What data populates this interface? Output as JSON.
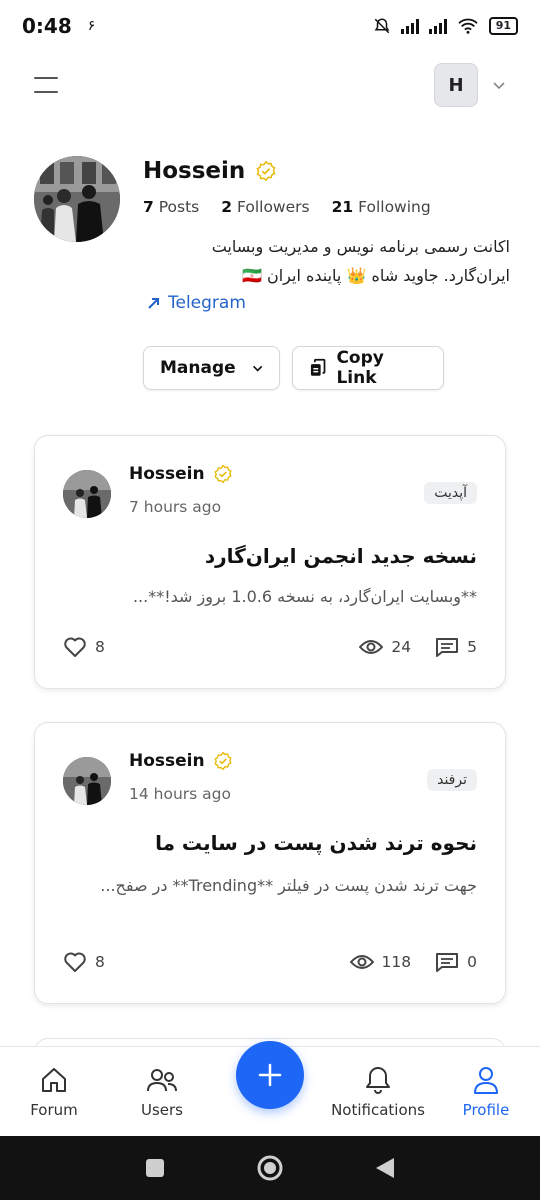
{
  "status_bar": {
    "time": "0:48",
    "extra": "۶",
    "battery": "91"
  },
  "header": {
    "avatar_letter": "H"
  },
  "profile": {
    "name": "Hossein",
    "posts_count": "7",
    "posts_label": "Posts",
    "followers_count": "2",
    "followers_label": "Followers",
    "following_count": "21",
    "following_label": "Following",
    "bio_line1": "اکانت رسمی برنامه نویس و مدیریت وبسایت",
    "bio_line2": "ایران‌گارد. جاوید شاه 👑 پاینده ایران 🇮🇷",
    "telegram_label": "Telegram",
    "manage_label": "Manage",
    "copy_link_label": "Copy Link"
  },
  "posts": [
    {
      "author": "Hossein",
      "time": "7 hours ago",
      "tag": "آپدیت",
      "title": "نسخه جدید انجمن ایران‌گارد",
      "excerpt": "**وبسایت ایران‌گارد، به نسخه 1.0.6 بروز شد!**...",
      "likes": "8",
      "views": "24",
      "comments": "5"
    },
    {
      "author": "Hossein",
      "time": "14 hours ago",
      "tag": "ترفند",
      "title": "نحوه ترند شدن پست در سایت ما",
      "excerpt": "جهت ترند شدن پست در فیلتر **Trending** در صفح...",
      "likes": "8",
      "views": "118",
      "comments": "0"
    }
  ],
  "bottom_nav": {
    "forum": "Forum",
    "users": "Users",
    "notifications": "Notifications",
    "profile": "Profile",
    "active": "profile"
  },
  "colors": {
    "accent": "#1e66f5",
    "verified": "#e6b800",
    "link": "#2563c9"
  },
  "icons": [
    "menu-icon",
    "chevron-down-icon",
    "verified-icon",
    "telegram-icon",
    "copy-icon",
    "heart-icon",
    "eye-icon",
    "comment-icon",
    "home-icon",
    "users-icon",
    "plus-icon",
    "bell-icon",
    "profile-icon"
  ]
}
